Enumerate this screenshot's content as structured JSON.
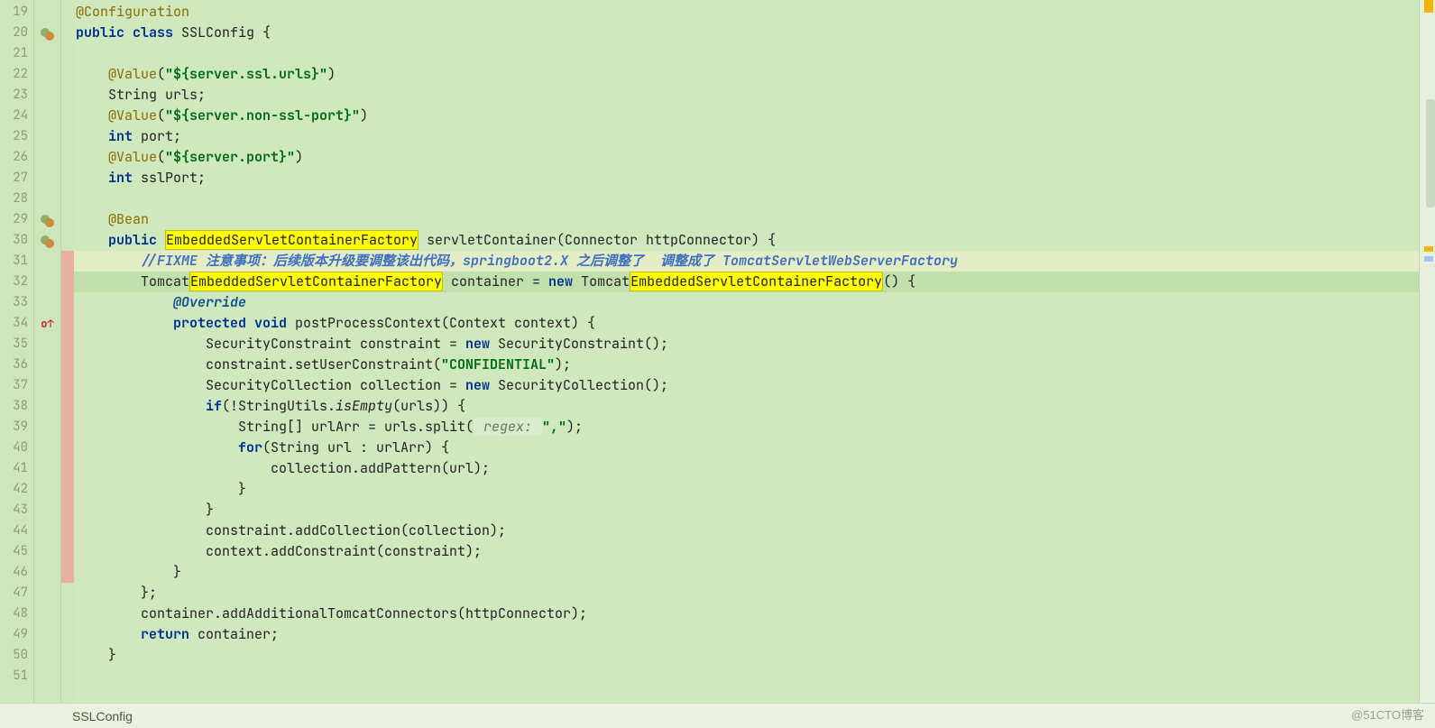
{
  "status_bar": {
    "breadcrumb": "SSLConfig"
  },
  "watermark": "@51CTO博客",
  "search_highlight": "EmbeddedServletContainerFactory",
  "gutter": {
    "start": 19,
    "end": 51,
    "markers": {
      "20": "implements",
      "29": "implements",
      "30": "implements",
      "34": "override"
    },
    "vcs_modified_lines": [
      31,
      32,
      33,
      34,
      35,
      36,
      37,
      38,
      39,
      40,
      41,
      42,
      43,
      44,
      45,
      46
    ]
  },
  "right_gutter": {
    "warning_top": true,
    "marks": [
      {
        "top_pct": 35,
        "kind": "warn"
      },
      {
        "top_pct": 36.5,
        "kind": "blue"
      }
    ]
  },
  "code": {
    "19": [
      {
        "t": "@Configuration",
        "c": "anno"
      }
    ],
    "20": [
      {
        "t": "public ",
        "c": "kw"
      },
      {
        "t": "class ",
        "c": "kw"
      },
      {
        "t": "SSLConfig {",
        "c": "ident"
      }
    ],
    "21": [],
    "22": [
      {
        "t": "    ",
        "c": ""
      },
      {
        "t": "@Value",
        "c": "anno"
      },
      {
        "t": "(",
        "c": "plain"
      },
      {
        "t": "\"${server.ssl.urls}\"",
        "c": "str"
      },
      {
        "t": ")",
        "c": "plain"
      }
    ],
    "23": [
      {
        "t": "    String urls;",
        "c": "plain"
      }
    ],
    "24": [
      {
        "t": "    ",
        "c": ""
      },
      {
        "t": "@Value",
        "c": "anno"
      },
      {
        "t": "(",
        "c": "plain"
      },
      {
        "t": "\"${server.non-ssl-port}\"",
        "c": "str"
      },
      {
        "t": ")",
        "c": "plain"
      }
    ],
    "25": [
      {
        "t": "    ",
        "c": ""
      },
      {
        "t": "int ",
        "c": "kw"
      },
      {
        "t": "port;",
        "c": "plain"
      }
    ],
    "26": [
      {
        "t": "    ",
        "c": ""
      },
      {
        "t": "@Value",
        "c": "anno"
      },
      {
        "t": "(",
        "c": "plain"
      },
      {
        "t": "\"${server.port}\"",
        "c": "str"
      },
      {
        "t": ")",
        "c": "plain"
      }
    ],
    "27": [
      {
        "t": "    ",
        "c": ""
      },
      {
        "t": "int ",
        "c": "kw"
      },
      {
        "t": "sslPort;",
        "c": "plain"
      }
    ],
    "28": [],
    "29": [
      {
        "t": "    ",
        "c": ""
      },
      {
        "t": "@Bean",
        "c": "anno"
      }
    ],
    "30": [
      {
        "t": "    ",
        "c": ""
      },
      {
        "t": "public ",
        "c": "kw"
      },
      {
        "t": "EmbeddedServletContainerFactory",
        "c": "plain",
        "hl": true
      },
      {
        "t": " servletContainer(Connector httpConnector) {",
        "c": "plain"
      }
    ],
    "31": [
      {
        "t": "        ",
        "c": ""
      },
      {
        "t": "//FIXME 注意事项：后续版本升级要调整该出代码，springboot2.X 之后调整了  调整成了 TomcatServletWebServerFactory",
        "c": "cmt"
      }
    ],
    "32": [
      {
        "t": "        Tomcat",
        "c": "plain"
      },
      {
        "t": "EmbeddedServletContainerFactory",
        "c": "plain",
        "hl": true
      },
      {
        "t": " container = ",
        "c": "plain"
      },
      {
        "t": "new ",
        "c": "kw"
      },
      {
        "t": "Tomcat",
        "c": "plain"
      },
      {
        "t": "EmbeddedServletContainerFactory",
        "c": "plain",
        "hl": true
      },
      {
        "t": "() {",
        "c": "plain"
      }
    ],
    "33": [
      {
        "t": "            ",
        "c": ""
      },
      {
        "t": "@Override",
        "c": "cmt-anno"
      }
    ],
    "34": [
      {
        "t": "            ",
        "c": ""
      },
      {
        "t": "protected ",
        "c": "kw"
      },
      {
        "t": "void ",
        "c": "kw"
      },
      {
        "t": "postProcessContext(Context context) {",
        "c": "plain"
      }
    ],
    "35": [
      {
        "t": "                SecurityConstraint constraint = ",
        "c": "plain"
      },
      {
        "t": "new ",
        "c": "kw"
      },
      {
        "t": "SecurityConstraint();",
        "c": "plain"
      }
    ],
    "36": [
      {
        "t": "                constraint.setUserConstraint(",
        "c": "plain"
      },
      {
        "t": "\"CONFIDENTIAL\"",
        "c": "str"
      },
      {
        "t": ");",
        "c": "plain"
      }
    ],
    "37": [
      {
        "t": "                SecurityCollection collection = ",
        "c": "plain"
      },
      {
        "t": "new ",
        "c": "kw"
      },
      {
        "t": "SecurityCollection();",
        "c": "plain"
      }
    ],
    "38": [
      {
        "t": "                ",
        "c": ""
      },
      {
        "t": "if",
        "c": "kw"
      },
      {
        "t": "(!StringUtils.",
        "c": "plain"
      },
      {
        "t": "isEmpty",
        "c": "plain",
        "i": true
      },
      {
        "t": "(urls)) {",
        "c": "plain"
      }
    ],
    "39": [
      {
        "t": "                    String[] urlArr = urls.split(",
        "c": "plain"
      },
      {
        "t": " regex: ",
        "c": "param-hint",
        "box": true
      },
      {
        "t": "\",\"",
        "c": "str"
      },
      {
        "t": ");",
        "c": "plain"
      }
    ],
    "40": [
      {
        "t": "                    ",
        "c": ""
      },
      {
        "t": "for",
        "c": "kw"
      },
      {
        "t": "(String url : urlArr) {",
        "c": "plain"
      }
    ],
    "41": [
      {
        "t": "                        collection.addPattern(url);",
        "c": "plain"
      }
    ],
    "42": [
      {
        "t": "                    }",
        "c": "plain"
      }
    ],
    "43": [
      {
        "t": "                }",
        "c": "plain"
      }
    ],
    "44": [
      {
        "t": "                constraint.addCollection(collection);",
        "c": "plain"
      }
    ],
    "45": [
      {
        "t": "                context.addConstraint(constraint);",
        "c": "plain"
      }
    ],
    "46": [
      {
        "t": "            }",
        "c": "plain"
      }
    ],
    "47": [
      {
        "t": "        };",
        "c": "plain"
      }
    ],
    "48": [
      {
        "t": "        container.addAdditionalTomcatConnectors(httpConnector);",
        "c": "plain"
      }
    ],
    "49": [
      {
        "t": "        ",
        "c": ""
      },
      {
        "t": "return ",
        "c": "kw"
      },
      {
        "t": "container;",
        "c": "plain"
      }
    ],
    "50": [
      {
        "t": "    }",
        "c": "plain"
      }
    ],
    "51": []
  }
}
